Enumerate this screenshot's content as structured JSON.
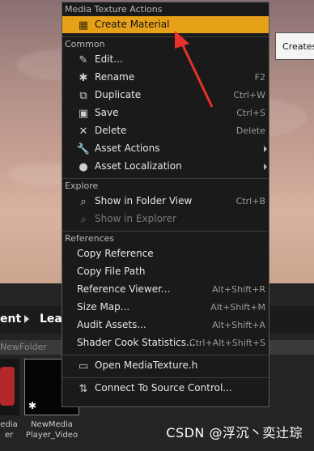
{
  "menu": {
    "sections": [
      {
        "header": "Media Texture Actions",
        "items": [
          {
            "name": "create-material",
            "icon": "material-icon",
            "label": "Create Material",
            "shortcut": "",
            "highlight": true
          }
        ]
      },
      {
        "header": "Common",
        "items": [
          {
            "name": "edit",
            "icon": "pencil-icon",
            "label": "Edit...",
            "shortcut": ""
          },
          {
            "name": "rename",
            "icon": "asterisk-icon",
            "label": "Rename",
            "shortcut": "F2"
          },
          {
            "name": "duplicate",
            "icon": "duplicate-icon",
            "label": "Duplicate",
            "shortcut": "Ctrl+W"
          },
          {
            "name": "save",
            "icon": "floppy-icon",
            "label": "Save",
            "shortcut": "Ctrl+S"
          },
          {
            "name": "delete",
            "icon": "x-icon",
            "label": "Delete",
            "shortcut": "Delete"
          },
          {
            "name": "asset-actions",
            "icon": "wrench-icon",
            "label": "Asset Actions",
            "shortcut": "",
            "submenu": true
          },
          {
            "name": "asset-localization",
            "icon": "globe-icon",
            "label": "Asset Localization",
            "shortcut": "",
            "submenu": true
          }
        ]
      },
      {
        "header": "Explore",
        "items": [
          {
            "name": "show-in-folder-view",
            "icon": "magnifier-icon",
            "label": "Show in Folder View",
            "shortcut": "Ctrl+B"
          },
          {
            "name": "show-in-explorer",
            "icon": "magnifier-icon",
            "label": "Show in Explorer",
            "shortcut": "",
            "disabled": true
          }
        ]
      },
      {
        "header": "References",
        "items": [
          {
            "name": "copy-reference",
            "icon": "",
            "label": "Copy Reference",
            "shortcut": ""
          },
          {
            "name": "copy-file-path",
            "icon": "",
            "label": "Copy File Path",
            "shortcut": ""
          },
          {
            "name": "reference-viewer",
            "icon": "",
            "label": "Reference Viewer...",
            "shortcut": "Alt+Shift+R"
          },
          {
            "name": "size-map",
            "icon": "",
            "label": "Size Map...",
            "shortcut": "Alt+Shift+M"
          },
          {
            "name": "audit-assets",
            "icon": "",
            "label": "Audit Assets...",
            "shortcut": "Alt+Shift+A"
          },
          {
            "name": "shader-cook-statistics",
            "icon": "",
            "label": "Shader Cook Statistics...",
            "shortcut": "Ctrl+Alt+Shift+S"
          }
        ]
      },
      {
        "header": "",
        "items": [
          {
            "name": "open-mediatexture-h",
            "icon": "code-file-icon",
            "label": "Open MediaTexture.h",
            "shortcut": ""
          }
        ]
      },
      {
        "header": "",
        "items": [
          {
            "name": "connect-to-source-control",
            "icon": "source-control-icon",
            "label": "Connect To Source Control...",
            "shortcut": ""
          }
        ]
      }
    ]
  },
  "tooltip": {
    "text": "Creates"
  },
  "breadcrumb": {
    "part1": "ent",
    "part2": "Lear"
  },
  "folder": {
    "name": "NewFolder"
  },
  "assets": [
    {
      "label_line1": "edia",
      "label_line2": "er"
    },
    {
      "label_line1": "NewMedia",
      "label_line2": "Player_Video"
    }
  ],
  "watermark": "CSDN @浮沉丶奕辻琮",
  "colors": {
    "highlight": "#e6a118",
    "menu_bg": "#1a1a1a",
    "annotation_arrow": "#e8312a"
  }
}
